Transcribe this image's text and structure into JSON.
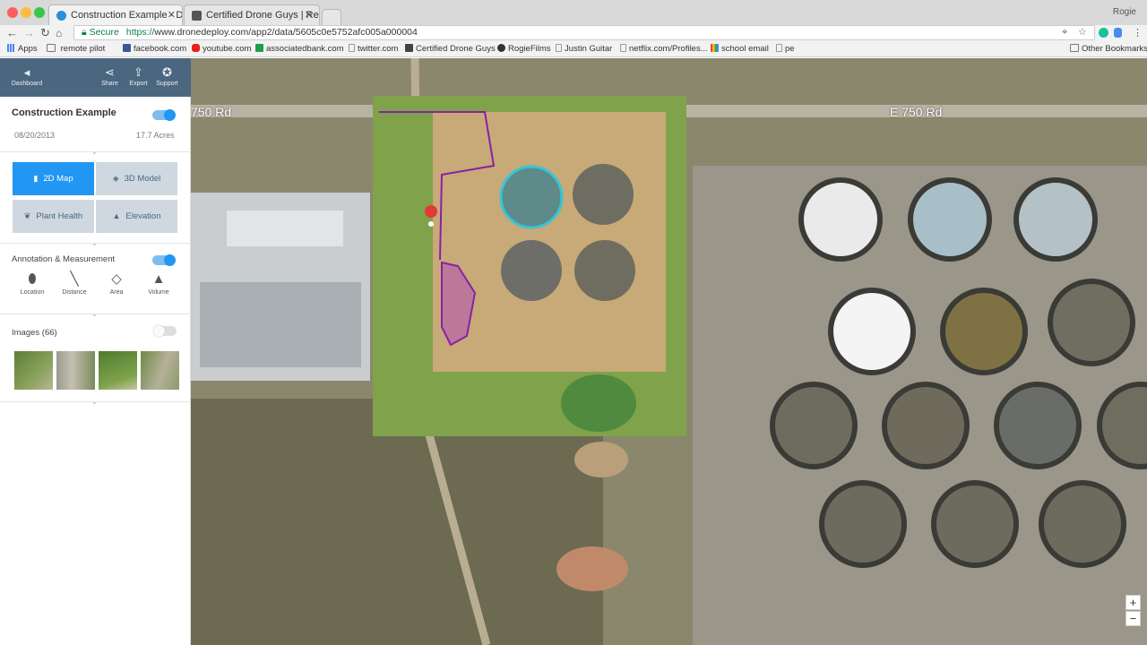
{
  "browser": {
    "tabs": [
      {
        "title": "Construction Example - Drone",
        "active": true
      },
      {
        "title": "Certified Drone Guys | Real E",
        "active": false
      }
    ],
    "profile_name": "Rogie",
    "address": {
      "secure_label": "Secure",
      "url_scheme": "https://",
      "url_rest": "www.dronedeploy.com/app2/data/5605c0e5752afc005a000004"
    },
    "bookmarks": [
      {
        "label": "Apps",
        "icon": "apps-grid-icon"
      },
      {
        "label": "remote pilot",
        "icon": "folder-icon"
      },
      {
        "label": "facebook.com",
        "icon": "facebook-icon"
      },
      {
        "label": "youtube.com",
        "icon": "youtube-icon"
      },
      {
        "label": "associatedbank.com",
        "icon": "bank-icon"
      },
      {
        "label": "twitter.com",
        "icon": "page-icon"
      },
      {
        "label": "Certified Drone Guys",
        "icon": "drone-icon"
      },
      {
        "label": "RogieFilms",
        "icon": "film-icon"
      },
      {
        "label": "Justin Guitar",
        "icon": "page-icon"
      },
      {
        "label": "netflix.com/Profiles...",
        "icon": "page-icon"
      },
      {
        "label": "school email",
        "icon": "google-icon"
      },
      {
        "label": "pe",
        "icon": "page-icon"
      }
    ],
    "other_bookmarks": "Other Bookmarks"
  },
  "sidebar": {
    "header": {
      "dashboard": "Dashboard",
      "share": "Share",
      "export": "Export",
      "support": "Support"
    },
    "project": {
      "title": "Construction Example",
      "date": "08/20/2013",
      "area": "17.7 Acres",
      "visible": true
    },
    "modes": [
      {
        "label": "2D Map",
        "active": true,
        "icon": "map-icon"
      },
      {
        "label": "3D Model",
        "active": false,
        "icon": "cube-icon"
      },
      {
        "label": "Plant Health",
        "active": false,
        "icon": "leaf-icon"
      },
      {
        "label": "Elevation",
        "active": false,
        "icon": "mountain-icon"
      }
    ],
    "annotation": {
      "label": "Annotation & Measurement",
      "enabled": true,
      "tools": [
        {
          "label": "Location",
          "icon": "pin-icon"
        },
        {
          "label": "Distance",
          "icon": "ruler-line-icon"
        },
        {
          "label": "Area",
          "icon": "polygon-icon"
        },
        {
          "label": "Volume",
          "icon": "pyramid-icon"
        }
      ]
    },
    "images": {
      "label": "Images (66)",
      "enabled": false
    }
  },
  "map": {
    "road_labels": [
      "750 Rd",
      "E 750 Rd"
    ],
    "zoom_in": "+",
    "zoom_out": "−"
  },
  "colors": {
    "header": "#4b6780",
    "accent": "#2196f3",
    "polygon_stroke": "#8a1fa8",
    "circle_highlight": "#35c6d6",
    "pin": "#e53935"
  }
}
